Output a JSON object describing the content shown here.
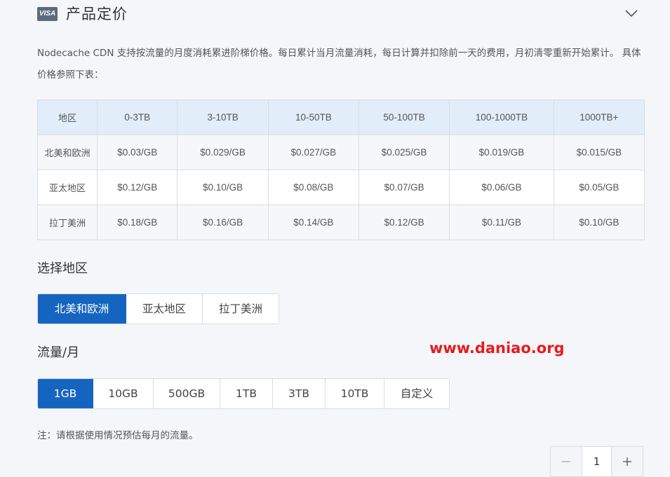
{
  "section": {
    "icon_text": "VISA",
    "title": "产品定价",
    "description": "Nodecache CDN 支持按流量的月度消耗累进阶梯价格。每日累计当月流量消耗，每日计算并扣除前一天的费用，月初清零重新开始累计。 具体价格参照下表："
  },
  "pricing_table": {
    "headers": [
      "地区",
      "0-3TB",
      "3-10TB",
      "10-50TB",
      "50-100TB",
      "100-1000TB",
      "1000TB+"
    ],
    "rows": [
      [
        "北美和欧洲",
        "$0.03/GB",
        "$0.029/GB",
        "$0.027/GB",
        "$0.025/GB",
        "$0.019/GB",
        "$0.015/GB"
      ],
      [
        "亚太地区",
        "$0.12/GB",
        "$0.10/GB",
        "$0.08/GB",
        "$0.07/GB",
        "$0.06/GB",
        "$0.05/GB"
      ],
      [
        "拉丁美洲",
        "$0.18/GB",
        "$0.16/GB",
        "$0.14/GB",
        "$0.12/GB",
        "$0.11/GB",
        "$0.10/GB"
      ]
    ]
  },
  "region_selector": {
    "label": "选择地区",
    "options": [
      "北美和欧洲",
      "亚太地区",
      "拉丁美洲"
    ],
    "selected": "北美和欧洲"
  },
  "traffic_selector": {
    "label": "流量/月",
    "options": [
      "1GB",
      "10GB",
      "500GB",
      "1TB",
      "3TB",
      "10TB",
      "自定义"
    ],
    "selected": "1GB"
  },
  "watermark": "www.daniao.org",
  "note": "注：请根据使用情况预估每月的流量。",
  "quantity": {
    "value": "1"
  },
  "colors": {
    "accent": "#1565c0",
    "table_header_bg": "#e1edf9",
    "watermark": "#e81b1b"
  }
}
